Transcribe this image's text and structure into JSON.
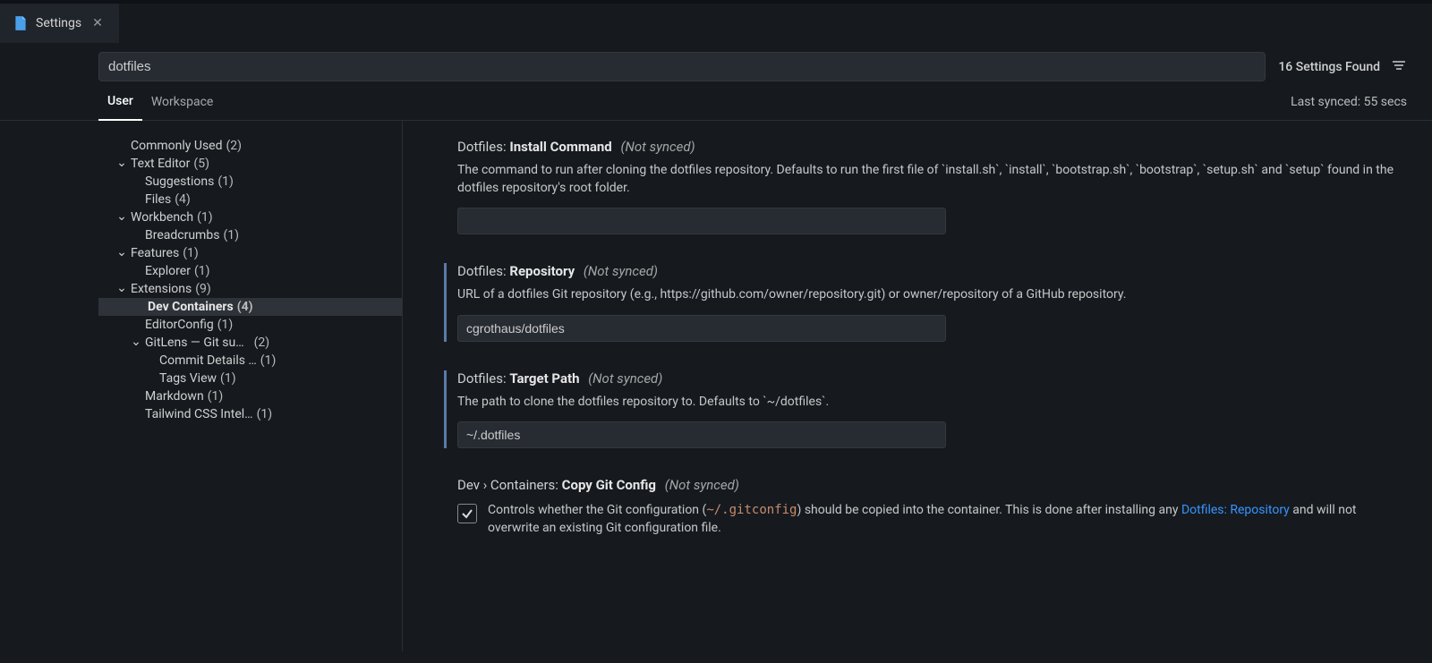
{
  "tab": {
    "title": "Settings"
  },
  "search": {
    "query": "dotfiles",
    "results_count": "16 Settings Found"
  },
  "scope_tabs": {
    "user": "User",
    "workspace": "Workspace"
  },
  "sync": {
    "last_synced": "Last synced: 55 secs"
  },
  "sidebar": {
    "commonly_used": {
      "label": "Commonly Used",
      "count": "(2)"
    },
    "text_editor": {
      "label": "Text Editor",
      "count": "(5)",
      "suggestions": {
        "label": "Suggestions",
        "count": "(1)"
      },
      "files": {
        "label": "Files",
        "count": "(4)"
      }
    },
    "workbench": {
      "label": "Workbench",
      "count": "(1)",
      "breadcrumbs": {
        "label": "Breadcrumbs",
        "count": "(1)"
      }
    },
    "features": {
      "label": "Features",
      "count": "(1)",
      "explorer": {
        "label": "Explorer",
        "count": "(1)"
      }
    },
    "extensions": {
      "label": "Extensions",
      "count": "(9)",
      "dev_containers": {
        "label": "Dev Containers",
        "count": "(4)"
      },
      "editorconfig": {
        "label": "EditorConfig",
        "count": "(1)"
      },
      "gitlens": {
        "label": "GitLens — Git su…",
        "count": "(2)",
        "commit_details": {
          "label": "Commit Details …",
          "count": "(1)"
        },
        "tags_view": {
          "label": "Tags View",
          "count": "(1)"
        }
      },
      "markdown": {
        "label": "Markdown",
        "count": "(1)"
      },
      "tailwind": {
        "label": "Tailwind CSS Intel…",
        "count": "(1)"
      }
    }
  },
  "settings": {
    "install_command": {
      "prefix": "Dotfiles: ",
      "name": "Install Command",
      "not_synced": "(Not synced)",
      "desc": "The command to run after cloning the dotfiles repository. Defaults to run the first file of `install.sh`, `install`, `bootstrap.sh`, `bootstrap`, `setup.sh` and `setup` found in the dotfiles repository's root folder.",
      "value": ""
    },
    "repository": {
      "prefix": "Dotfiles: ",
      "name": "Repository",
      "not_synced": "(Not synced)",
      "desc": "URL of a dotfiles Git repository (e.g., https://github.com/owner/repository.git) or owner/repository of a GitHub repository.",
      "value": "cgrothaus/dotfiles"
    },
    "target_path": {
      "prefix": "Dotfiles: ",
      "name": "Target Path",
      "not_synced": "(Not synced)",
      "desc": "The path to clone the dotfiles repository to. Defaults to `~/dotfiles`.",
      "value": "~/.dotfiles"
    },
    "copy_git": {
      "prefix": "Dev › Containers: ",
      "name": "Copy Git Config",
      "not_synced": "(Not synced)",
      "desc_part1": "Controls whether the Git configuration (",
      "desc_code": "~/.gitconfig",
      "desc_part2": ") should be copied into the container. This is done after installing any ",
      "desc_link": "Dotfiles: Repository",
      "desc_part3": " and will not overwrite an existing Git configuration file.",
      "checked": true
    }
  }
}
